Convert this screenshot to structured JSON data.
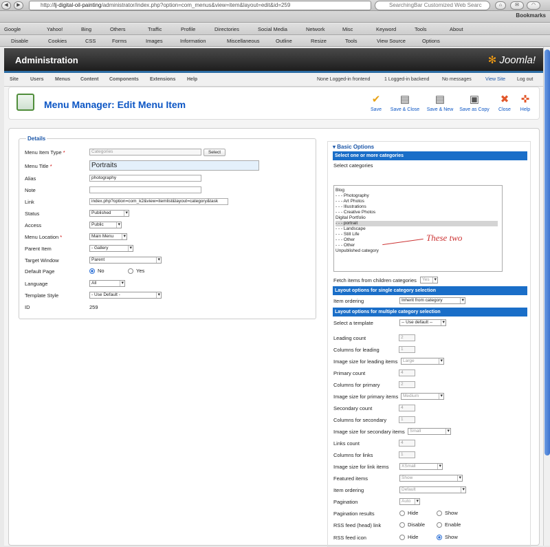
{
  "browser": {
    "url_prefix": "http://",
    "url_host": "lj-digital-oil-painting",
    "url_rest": "/administrator/index.php?option=com_menus&view=item&layout=edit&id=259",
    "search_placeholder": "SearchingBar Customized Web Searc",
    "bookmarks": "Bookmarks",
    "toolbar1": [
      "Google",
      "Yahoo!",
      "Bing",
      "Others",
      "Traffic",
      "Profile",
      "Directories",
      "Social Media",
      "Network",
      "Misc",
      "Keyword",
      "Tools",
      "About"
    ],
    "toolbar2": [
      "Disable",
      "Cookies",
      "CSS",
      "Forms",
      "Images",
      "Information",
      "Miscellaneous",
      "Outline",
      "Resize",
      "Tools",
      "View Source",
      "Options"
    ]
  },
  "admin": {
    "title": "Administration",
    "brand": "Joomla!"
  },
  "menu": {
    "items": [
      "Site",
      "Users",
      "Menus",
      "Content",
      "Components",
      "Extensions",
      "Help"
    ],
    "status": {
      "frontend": "None Logged-in frontend",
      "backend": "1 Logged-in backend",
      "messages": "No messages",
      "view_site": "View Site",
      "logout": "Log out"
    }
  },
  "toolbar": {
    "title": "Menu Manager: Edit Menu Item",
    "save": "Save",
    "save_close": "Save & Close",
    "save_new": "Save & New",
    "save_copy": "Save as Copy",
    "close": "Close",
    "help": "Help"
  },
  "details": {
    "legend": "Details",
    "menu_item_type_label": "Menu Item Type",
    "menu_item_type_value": "Categories",
    "select_btn": "Select",
    "menu_title_label": "Menu Title",
    "menu_title_value": "Portraits",
    "alias_label": "Alias",
    "alias_value": "photography",
    "note_label": "Note",
    "note_value": "",
    "link_label": "Link",
    "link_value": "index.php?option=com_k2&view=itemlist&layout=category&task",
    "status_label": "Status",
    "status_value": "Published",
    "access_label": "Access",
    "access_value": "Public",
    "menu_location_label": "Menu Location",
    "menu_location_value": "Main Menu",
    "parent_label": "Parent Item",
    "parent_value": "- Gallery",
    "target_label": "Target Window",
    "target_value": "Parent",
    "default_label": "Default Page",
    "default_no": "No",
    "default_yes": "Yes",
    "language_label": "Language",
    "language_value": "All",
    "template_label": "Template Style",
    "template_value": "- Use Default -",
    "id_label": "ID",
    "id_value": "259"
  },
  "basic": {
    "title": "Basic Options",
    "head_categories": "Select one or more categories",
    "select_categories": "Select categories",
    "categories": [
      "Blog",
      "- - - Photography",
      "- - - Art Photos",
      "- - - Illustrations",
      "- - - Creative Photos",
      "Digital Portfolio",
      "- - - portrait",
      "- - - Landscape",
      "- - - Still Life",
      "- - - Other",
      "- - - Other",
      "Unpublished category"
    ],
    "annotation": "These two",
    "fetch_label": "Fetch items from children categories",
    "fetch_value": "Yes",
    "head_single": "Layout options for single category selection",
    "item_ordering_label": "Item ordering",
    "item_ordering_single": "Inherit from category",
    "head_multi": "Layout options for multiple category selection",
    "template_label": "Select a template",
    "template_value": "-- Use default --",
    "leading_count_label": "Leading count",
    "leading_count": "2",
    "cols_leading_label": "Columns for leading",
    "cols_leading": "1",
    "img_leading_label": "Image size for leading items",
    "img_leading": "Large",
    "primary_count_label": "Primary count",
    "primary_count": "4",
    "cols_primary_label": "Columns for primary",
    "cols_primary": "2",
    "img_primary_label": "Image size for primary items",
    "img_primary": "Medium",
    "secondary_count_label": "Secondary count",
    "secondary_count": "4",
    "cols_secondary_label": "Columns for secondary",
    "cols_secondary": "1",
    "img_secondary_label": "Image size for secondary items",
    "img_secondary": "Small",
    "links_count_label": "Links count",
    "links_count": "4",
    "cols_links_label": "Columns for links",
    "cols_links": "1",
    "img_links_label": "Image size for link items",
    "img_links": "XSmall",
    "featured_label": "Featured items",
    "featured": "Show",
    "ordering_label": "Item ordering",
    "ordering": "Default",
    "pagination_label": "Pagination",
    "pagination": "Auto",
    "pag_results_label": "Pagination results",
    "hide": "Hide",
    "show": "Show",
    "rss_link_label": "RSS feed (head) link",
    "disable": "Disable",
    "enable": "Enable",
    "rss_icon_label": "RSS feed icon"
  }
}
